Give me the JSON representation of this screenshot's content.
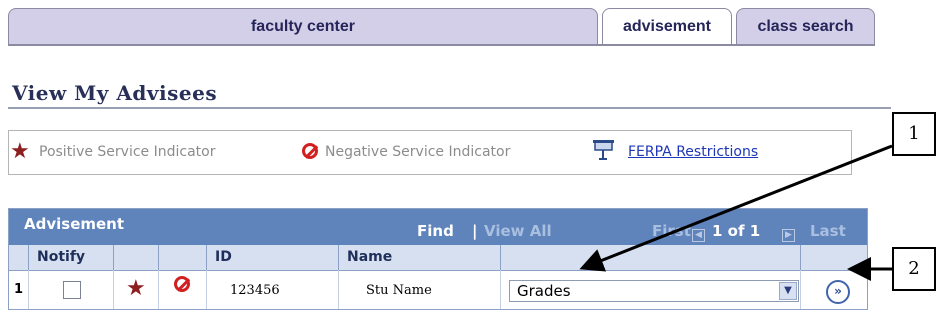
{
  "tabs": {
    "faculty_center": "faculty center",
    "advisement": "advisement",
    "class_search": "class search"
  },
  "page_title": "View My Advisees",
  "legend": {
    "positive": "Positive Service Indicator",
    "negative": "Negative Service Indicator",
    "ferpa": "FERPA Restrictions"
  },
  "grid": {
    "title": "Advisement",
    "find": "Find",
    "separator": "|",
    "view_all": "View All",
    "first": "First",
    "page_of": "1 of 1",
    "last": "Last",
    "columns": [
      "Notify",
      "",
      "",
      "ID",
      "Name",
      "",
      ""
    ],
    "rows": [
      {
        "num": "1",
        "id": "123456",
        "name": "Stu Name",
        "action": "Grades"
      }
    ]
  },
  "callouts": {
    "one": "1",
    "two": "2"
  },
  "colors": {
    "header_blue": "#5f83bb",
    "tab_purple": "#d4cfe8",
    "star_red": "#8c1f1f",
    "no_red": "#d22020"
  }
}
